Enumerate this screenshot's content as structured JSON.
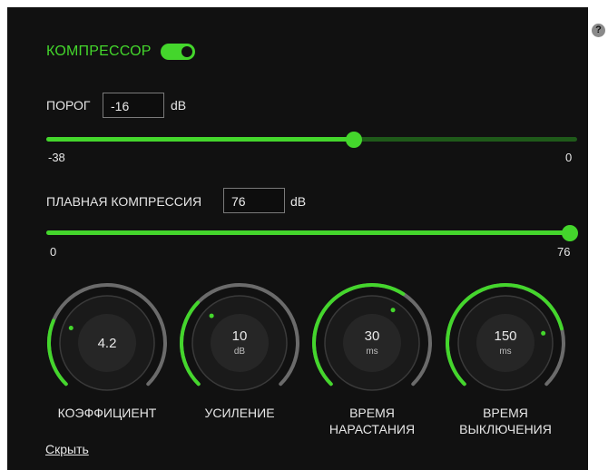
{
  "compressor": {
    "title": "КОМПРЕССОР",
    "enabled": true,
    "accent_color": "#44d62c"
  },
  "threshold": {
    "label": "ПОРОГ",
    "value": "-16",
    "unit": "dB",
    "min_label": "-38",
    "max_label": "0",
    "fraction": 0.58
  },
  "soft_knee": {
    "label": "ПЛАВНАЯ КОМПРЕССИЯ",
    "value": "76",
    "unit": "dB",
    "min_label": "0",
    "max_label": "76",
    "fraction": 1.0
  },
  "knobs": [
    {
      "label": "КОЭФФИЦИЕНТ",
      "value": "4.2",
      "unit": "",
      "fraction": 0.25
    },
    {
      "label": "УСИЛЕНИЕ",
      "value": "10",
      "unit": "dB",
      "fraction": 0.33
    },
    {
      "label": "ВРЕМЯ\nНАРАСТАНИЯ",
      "value": "30",
      "unit": "ms",
      "fraction": 0.62
    },
    {
      "label": "ВРЕМЯ\nВЫКЛЮЧЕНИЯ",
      "value": "150",
      "unit": "ms",
      "fraction": 0.78
    }
  ],
  "hide_link": "Скрыть",
  "help_icon": "question-icon",
  "help_glyph": "?"
}
